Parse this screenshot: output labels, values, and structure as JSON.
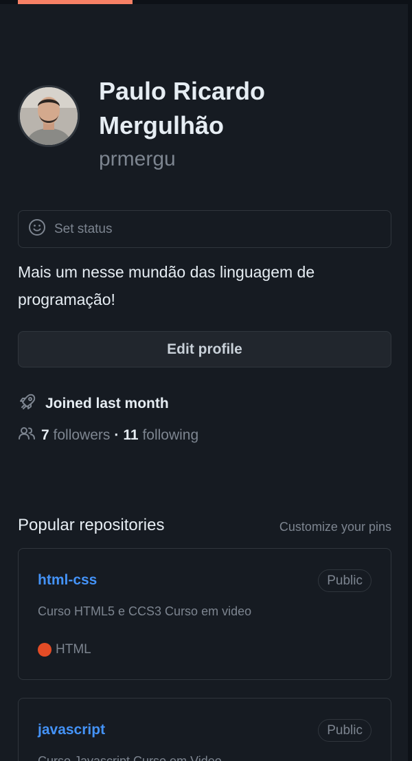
{
  "profile": {
    "full_name": "Paulo Ricardo Mergulhão",
    "username": "prmergu",
    "status_placeholder": "Set status",
    "bio": "Mais um nesse mundão das linguagem de programação!",
    "edit_button": "Edit profile",
    "joined": "Joined last month",
    "followers_count": "7",
    "followers_label": "followers",
    "separator": "·",
    "following_count": "11",
    "following_label": "following"
  },
  "repositories": {
    "title": "Popular repositories",
    "customize_link": "Customize your pins",
    "items": [
      {
        "name": "html-css",
        "visibility": "Public",
        "description": "Curso HTML5 e CCS3 Curso em video",
        "language": "HTML",
        "language_color": "#e34c26"
      },
      {
        "name": "javascript",
        "visibility": "Public",
        "description": "Curso Javascript Curso em Video"
      }
    ]
  },
  "colors": {
    "background": "#161b22",
    "accent_tab": "#f78166",
    "link": "#4493f8"
  },
  "icons": {
    "status": "smiley-icon",
    "joined": "rocket-icon",
    "followers": "people-icon"
  }
}
